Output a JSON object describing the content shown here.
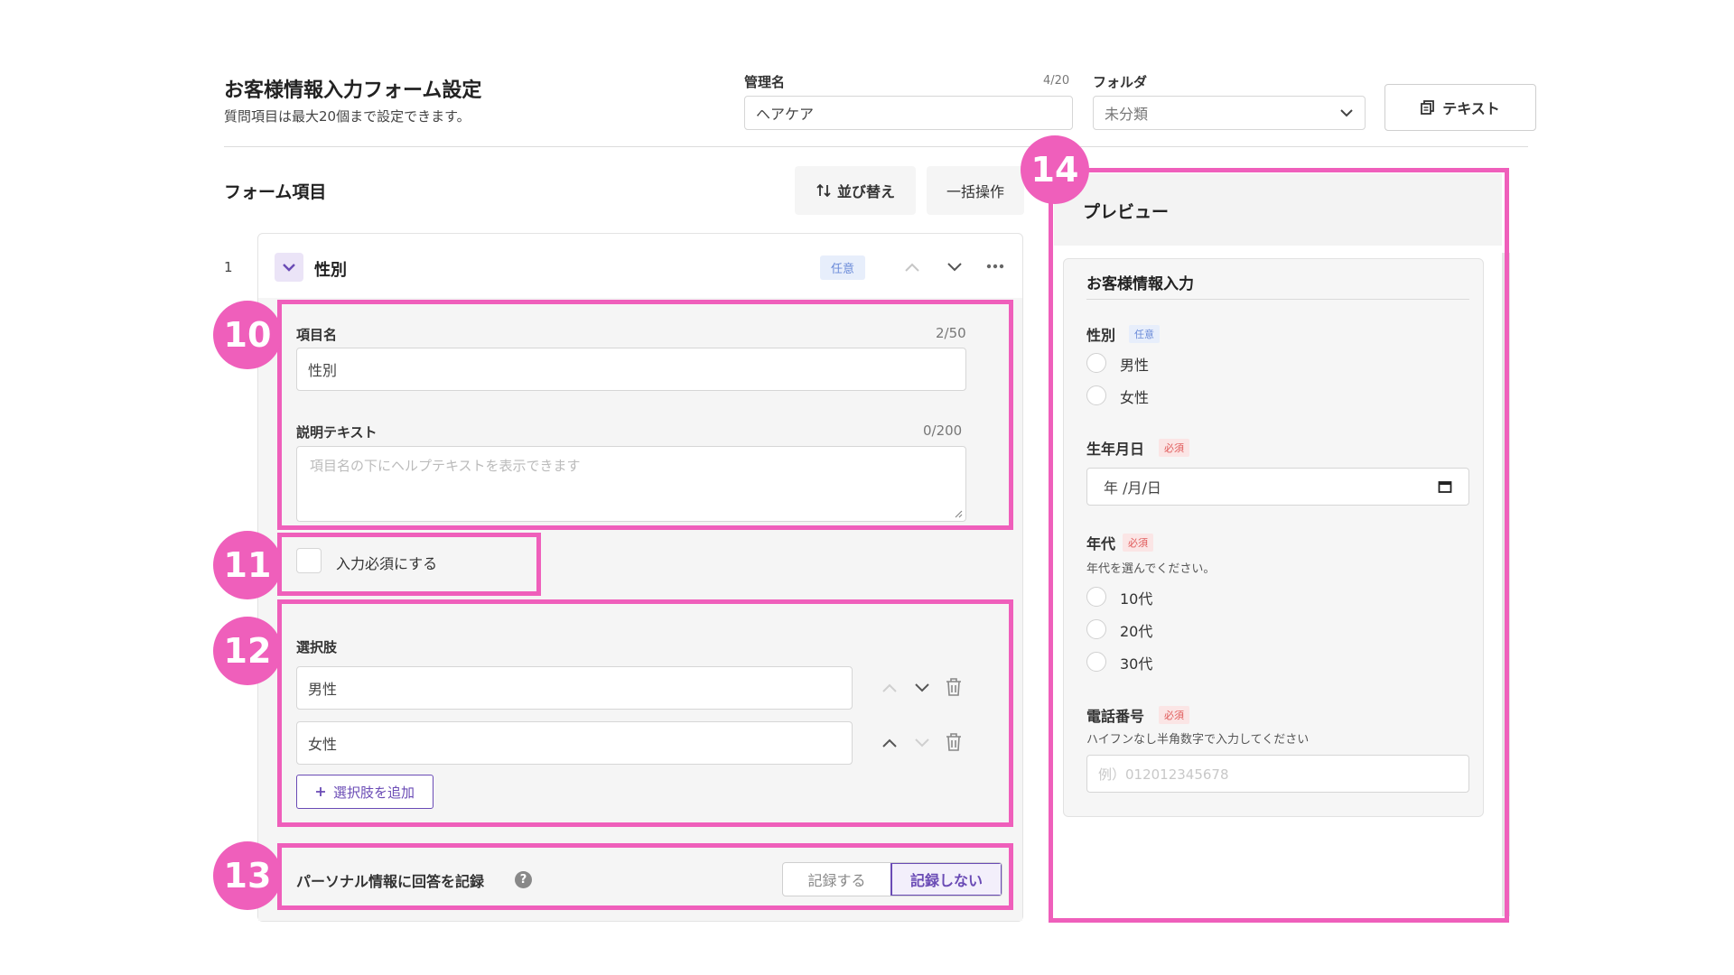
{
  "header": {
    "title": "お客様情報入力フォーム設定",
    "subtitle": "質問項目は最大20個まで設定できます。",
    "admin_name_label": "管理名",
    "admin_name_counter": "4/20",
    "admin_name_value": "ヘアケア",
    "folder_label": "フォルダ",
    "folder_value": "未分類",
    "text_button": "テキスト"
  },
  "form_items": {
    "heading": "フォーム項目",
    "sort_button": "並び替え",
    "bulk_button": "一括操作",
    "item": {
      "index": "1",
      "title": "性別",
      "badge": "任意",
      "name_label": "項目名",
      "name_counter": "2/50",
      "name_value": "性別",
      "desc_label": "説明テキスト",
      "desc_counter": "0/200",
      "desc_placeholder": "項目名の下にヘルプテキストを表示できます",
      "required_label": "入力必須にする",
      "choices_label": "選択肢",
      "choices": [
        "男性",
        "女性"
      ],
      "add_choice": "選択肢を追加",
      "personal_label": "パーソナル情報に回答を記録",
      "record_on": "記録する",
      "record_off": "記録しない"
    }
  },
  "annotations": [
    "10",
    "11",
    "12",
    "13",
    "14"
  ],
  "preview": {
    "heading": "プレビュー",
    "form_title": "お客様情報入力",
    "gender_label": "性別",
    "gender_badge": "任意",
    "gender_options": [
      "男性",
      "女性"
    ],
    "birth_label": "生年月日",
    "birth_badge": "必須",
    "birth_value": "年 /月/日",
    "age_label": "年代",
    "age_badge": "必須",
    "age_help": "年代を選んでください。",
    "age_options": [
      "10代",
      "20代",
      "30代"
    ],
    "phone_label": "電話番号",
    "phone_badge": "必須",
    "phone_help": "ハイフンなし半角数字で入力してください",
    "phone_placeholder": "例）012012345678"
  },
  "colors": {
    "accent": "#ef5fbb",
    "purple": "#6a4bb5",
    "optional_badge": "#6a8ad8",
    "required_badge": "#e05a5a"
  }
}
